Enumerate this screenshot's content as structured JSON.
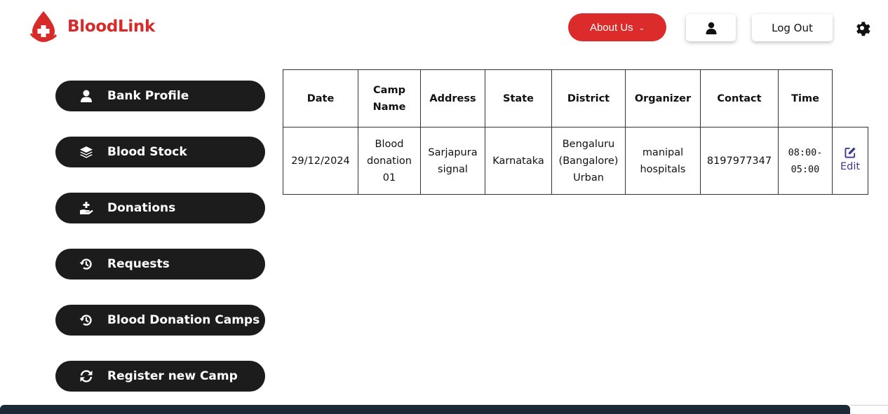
{
  "brand": {
    "name": "BloodLink",
    "color": "#d72b2b"
  },
  "header": {
    "about_label": "About Us",
    "logout_label": "Log Out",
    "icons": {
      "user": "user-icon",
      "settings": "gear-icon",
      "dropdown": "chevron-down-icon"
    }
  },
  "sidebar": {
    "items": [
      {
        "label": "Bank Profile",
        "icon": "user-icon"
      },
      {
        "label": "Blood Stock",
        "icon": "layers-icon"
      },
      {
        "label": "Donations",
        "icon": "hand-donate-icon"
      },
      {
        "label": "Requests",
        "icon": "history-icon"
      },
      {
        "label": "Blood Donation Camps",
        "icon": "history-icon"
      },
      {
        "label": "Register new Camp",
        "icon": "refresh-icon"
      }
    ]
  },
  "table": {
    "headers": [
      "Date",
      "Camp Name",
      "Address",
      "State",
      "District",
      "Organizer",
      "Contact",
      "Time"
    ],
    "rows": [
      {
        "date": "29/12/2024",
        "camp_name": "Blood donation 01",
        "address": "Sarjapura signal",
        "state": "Karnataka",
        "district": "Bengaluru (Bangalore) Urban",
        "organizer": "manipal hospitals",
        "contact": "8197977347",
        "time": "08:00-05:00",
        "edit_label": "Edit"
      }
    ]
  },
  "colors": {
    "accent": "#dc2b2b",
    "sidebar_bg": "#1c1c1c",
    "link": "#3b3b8f"
  }
}
